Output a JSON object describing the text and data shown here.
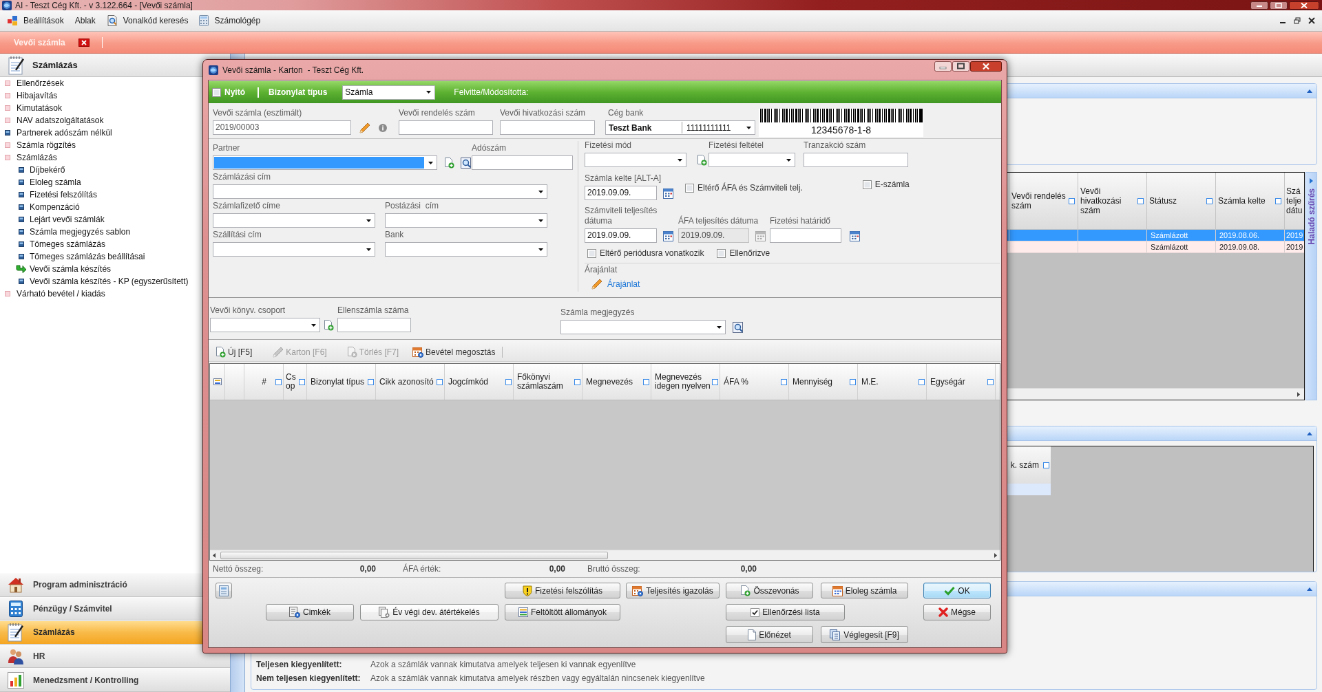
{
  "title_bar": {
    "title": "AI - Teszt Cég Kft. - v 3.122.664 - [Vevői számla]"
  },
  "menu_bar": [
    {
      "kind": "settings",
      "label": "Beállítások"
    },
    {
      "kind": "plain",
      "label": "Ablak"
    },
    {
      "kind": "barcode",
      "label": "Vonalkód keresés"
    },
    {
      "kind": "calculator",
      "label": "Számológép"
    }
  ],
  "document_tabs": [
    {
      "label": "Vevői számla",
      "selected": true
    }
  ],
  "sidebar": {
    "title": "Számlázás",
    "items": [
      {
        "kind": "group",
        "label": "Ellenőrzések",
        "selected": false
      },
      {
        "kind": "group",
        "label": "Hibajavítás",
        "selected": false
      },
      {
        "kind": "group",
        "label": "Kimutatások",
        "selected": false
      },
      {
        "kind": "group",
        "label": "NAV adatszolgáltatások",
        "selected": false
      },
      {
        "kind": "item",
        "label": "Partnerek adószám nélkül",
        "selected": false
      },
      {
        "kind": "group",
        "label": "Számla rögzítés",
        "selected": false
      },
      {
        "kind": "group",
        "label": "Számlázás",
        "selected": false,
        "children": [
          {
            "kind": "item",
            "label": "Díjbekérő",
            "selected": false
          },
          {
            "kind": "item",
            "label": "Eloleg számla",
            "selected": false
          },
          {
            "kind": "item",
            "label": "Fizetési felszólítás",
            "selected": false
          },
          {
            "kind": "item",
            "label": "Kompenzáció",
            "selected": false
          },
          {
            "kind": "item",
            "label": "Lejárt vevői számlák",
            "selected": false
          },
          {
            "kind": "item",
            "label": "Számla megjegyzés sablon",
            "selected": false
          },
          {
            "kind": "item",
            "label": "Tömeges számlázás",
            "selected": false
          },
          {
            "kind": "item",
            "label": "Tömeges számlázás beállításai",
            "selected": false
          },
          {
            "label": "Vevői számla készítés",
            "selected": true
          },
          {
            "kind": "item",
            "label": "Vevői számla készítés - KP (egyszerűsített)",
            "selected": false
          }
        ]
      },
      {
        "kind": "group",
        "label": "Várható bevétel / kiadás",
        "selected": false
      }
    ]
  },
  "modules": [
    {
      "kind": "admin",
      "label": "Program adminisztráció",
      "selected": false
    },
    {
      "kind": "finance",
      "label": "Pénzügy / Számvitel",
      "selected": false
    },
    {
      "kind": "invoicing",
      "label": "Számlázás",
      "selected": true
    },
    {
      "kind": "hr",
      "label": "HR",
      "selected": false
    },
    {
      "kind": "management",
      "label": "Menedzsment / Kontrolling",
      "selected": false
    }
  ],
  "list_view": {
    "grid": {
      "columns": [
        "Vevői rendelés szám",
        "Vevői hivatkozási szám",
        "Státusz",
        "Számla kelte",
        "Szá telje dátu"
      ],
      "rows": [
        {
          "selected": true,
          "status": "Számlázott",
          "invoice_date": "2019.08.06.",
          "column_5": "2019"
        },
        {
          "selected": false,
          "status": "Számlázott",
          "invoice_date": "2019.09.08.",
          "column_5": "2019"
        }
      ]
    },
    "side_tab": "Haladó szűrés",
    "detail_grid": {
      "columns": [
        "k. szám"
      ]
    },
    "legend": [
      {
        "term": "Teljesen kiegyenlített:",
        "text": "Azok a számlák vannak kimutatva amelyek teljesen ki vannak egyenlítve"
      },
      {
        "term": "Nem teljesen kiegyenlített:",
        "text": "Azok a számlák vannak kimutatva amelyek részben vagy egyáltalán nincsenek kiegyenlítve"
      }
    ]
  },
  "dialog": {
    "title": "Vevői számla - Karton  - Teszt Cég Kft.",
    "header": {
      "opening": {
        "label": "Nyitó",
        "checked": false
      },
      "document_type": {
        "label": "Bizonylat típus",
        "value": "Számla"
      },
      "entered_by": {
        "label": "Felvitte/Módosította:"
      }
    },
    "form": {
      "invoice_number": {
        "label": "Vevői számla (esztimált)",
        "value": "2019/00003"
      },
      "order_number": {
        "label": "Vevői rendelés szám"
      },
      "reference_number": {
        "label": "Vevői hivatkozási szám"
      },
      "company_bank": {
        "label": "Cég bank",
        "bank": "Teszt Bank",
        "account": "11111111111"
      },
      "barcode": {
        "number": "12345678-1-8"
      },
      "partner": {
        "label": "Partner",
        "focused": true
      },
      "tax_number": {
        "label": "Adószám"
      },
      "billing_address": {
        "label": "Számlázási cím"
      },
      "payer_address": {
        "label": "Számlafizető címe"
      },
      "postal_address": {
        "label": "Postázási  cím"
      },
      "shipping_address": {
        "label": "Szállítási cím"
      },
      "bank": {
        "label": "Bank"
      },
      "payment_method": {
        "label": "Fizetési mód"
      },
      "payment_terms": {
        "label": "Fizetési feltétel"
      },
      "transaction_number": {
        "label": "Tranzakció szám"
      },
      "invoice_date": {
        "label": "Számla kelte [ALT-A]",
        "value": "2019.09.09."
      },
      "different_vat": {
        "label": "Eltérő ÁFA és Számviteli telj.",
        "checked": false
      },
      "e_invoice": {
        "label": "E-számla",
        "checked": false
      },
      "accounting_date": {
        "label": "Számviteli teljesítés dátuma",
        "value": "2019.09.09."
      },
      "vat_date": {
        "label": "ÁFA teljesítés dátuma",
        "value": "2019.09.09.",
        "disabled": true
      },
      "due_date": {
        "label": "Fizetési határidő"
      },
      "different_period": {
        "label": "Eltérő periódusra vonatkozik",
        "checked": false
      },
      "verified": {
        "label": "Ellenőrizve",
        "checked": false
      },
      "quote": {
        "label": "Árajánlat",
        "link": "Árajánlat"
      },
      "ledger_group": {
        "label": "Vevői könyv. csoport"
      },
      "counter_invoice": {
        "label": "Ellenszámla száma"
      },
      "note": {
        "label": "Számla megjegyzés"
      }
    },
    "toolbar": [
      {
        "kind": "new",
        "label": "Új [F5]",
        "disabled": false
      },
      {
        "kind": "edit",
        "label": "Karton [F6]",
        "disabled": true
      },
      {
        "kind": "delete",
        "label": "Törlés [F7]",
        "disabled": true
      },
      {
        "kind": "split",
        "label": "Bevétel megosztás",
        "disabled": false
      }
    ],
    "items_grid": {
      "columns": [
        "#",
        "Cs op",
        "Bizonylat típus",
        "Cikk azonosító",
        "Jogcímkód",
        "Főkönyvi számlaszám",
        "Megnevezés",
        "Megnevezés idegen nyelven",
        "ÁFA %",
        "Mennyiség",
        "M.E.",
        "Egységár"
      ]
    },
    "totals": [
      {
        "label": "Nettó összeg:",
        "value": "0,00"
      },
      {
        "label": "ÁFA érték:",
        "value": "0,00"
      },
      {
        "label": "Bruttó összeg:",
        "value": "0,00"
      }
    ],
    "buttons": [
      {
        "kind": "report",
        "default": false
      },
      {
        "kind": "warning",
        "label": "Fizetési felszólítás",
        "default": false
      },
      {
        "kind": "certificate",
        "label": "Teljesítés igazolás",
        "default": false
      },
      {
        "kind": "merge",
        "label": "Összevonás",
        "default": false
      },
      {
        "kind": "advance",
        "label": "Eloleg számla",
        "default": false
      },
      {
        "kind": "ok",
        "label": "OK",
        "default": true
      },
      {
        "kind": "tags",
        "label": "Cimkék",
        "default": false
      },
      {
        "kind": "revaluation",
        "label": "Év végi dev. átértékelés",
        "default": false
      },
      {
        "kind": "files",
        "label": "Feltöltött állományok",
        "default": false
      },
      {
        "kind": "checklist",
        "label": "Ellenőrzési lista",
        "checked": true,
        "default": false
      },
      {
        "kind": "cancel",
        "label": "Mégse",
        "default": false
      },
      {
        "kind": "preview",
        "label": "Előnézet",
        "default": false
      },
      {
        "kind": "finalize",
        "label": "Véglegesít [F9]",
        "default": false
      }
    ]
  }
}
